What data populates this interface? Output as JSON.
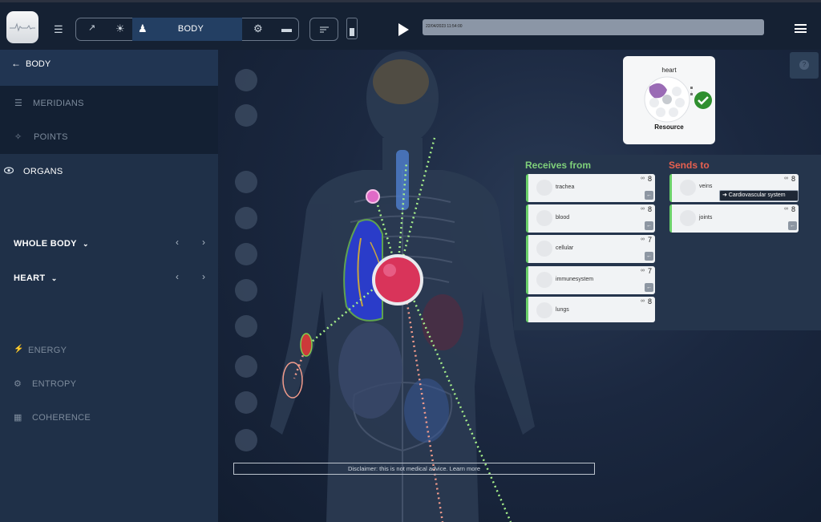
{
  "header": {
    "mode_label": "BODY",
    "timestamp": "22/04/2023 11:54:00",
    "icons": [
      "logo-waveform",
      "list-icon",
      "trend-icon",
      "sun-icon",
      "person-icon",
      "dots-icon",
      "card-icon",
      "sort-icon",
      "phone-icon",
      "play-icon",
      "hamburger-icon"
    ]
  },
  "sidebar": {
    "back_label": "BODY",
    "items": [
      {
        "label": "MERIDIANS",
        "icon": "list-icon"
      },
      {
        "label": "POINTS",
        "icon": "sparkle-icon"
      },
      {
        "label": "ORGANS",
        "icon": "eye-icon"
      }
    ],
    "selectors": [
      {
        "label": "WHOLE BODY"
      },
      {
        "label": "HEART"
      }
    ],
    "metrics": [
      {
        "label": "ENERGY",
        "icon": "bolt-icon"
      },
      {
        "label": "ENTROPY",
        "icon": "gear-icon"
      },
      {
        "label": "COHERENCE",
        "icon": "grid-icon"
      }
    ]
  },
  "organ_card": {
    "title": "heart",
    "subtitle": "Resource"
  },
  "flows": {
    "receives_title": "Receives from",
    "sends_title": "Sends to",
    "receives": [
      {
        "name": "trachea",
        "count": "8"
      },
      {
        "name": "blood",
        "count": "8"
      },
      {
        "name": "cellular",
        "count": "7"
      },
      {
        "name": "immunesystem",
        "count": "7"
      },
      {
        "name": "lungs",
        "count": "8"
      }
    ],
    "sends": [
      {
        "name": "veins",
        "count": "8"
      },
      {
        "name": "joints",
        "count": "8"
      }
    ],
    "tooltip": "➜ Cardiovascular system"
  },
  "disclaimer": "Disclaimer: this is not medical advice. Learn more",
  "help_label": "?",
  "colors": {
    "receives": "#7fd07a",
    "sends": "#e8604f",
    "accent": "#233f63"
  }
}
